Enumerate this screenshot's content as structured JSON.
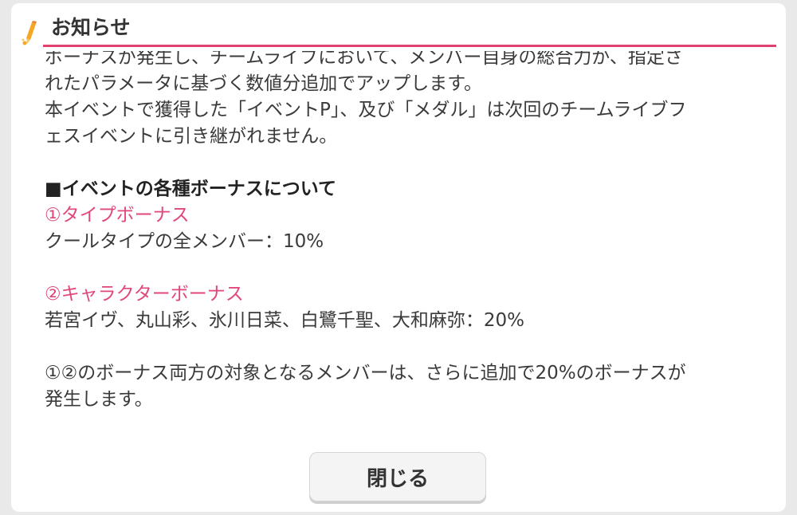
{
  "dialog": {
    "title": "お知らせ",
    "close_label": "閉じる",
    "header_icon": "pencil-icon",
    "accent_color": "#e0416e"
  },
  "content": {
    "lines": [
      "ボーナスが発生し、チームライブにおいて、メンバー自身の総合力が、指定さ",
      "れたパラメータに基づく数値分追加でアップします。",
      "本イベントで獲得した「イベントP」、及び「メダル」は次回のチームライブフ",
      "ェスイベントに引き継がれません。",
      "■イベントの各種ボーナスについて",
      "①タイプボーナス",
      "クールタイプの全メンバー：10%",
      "②キャラクターボーナス",
      "若宮イヴ、丸山彩、氷川日菜、白鷺千聖、大和麻弥：20%",
      "①②のボーナス両方の対象となるメンバーは、さらに追加で20%のボーナスが",
      "発生します。"
    ]
  }
}
